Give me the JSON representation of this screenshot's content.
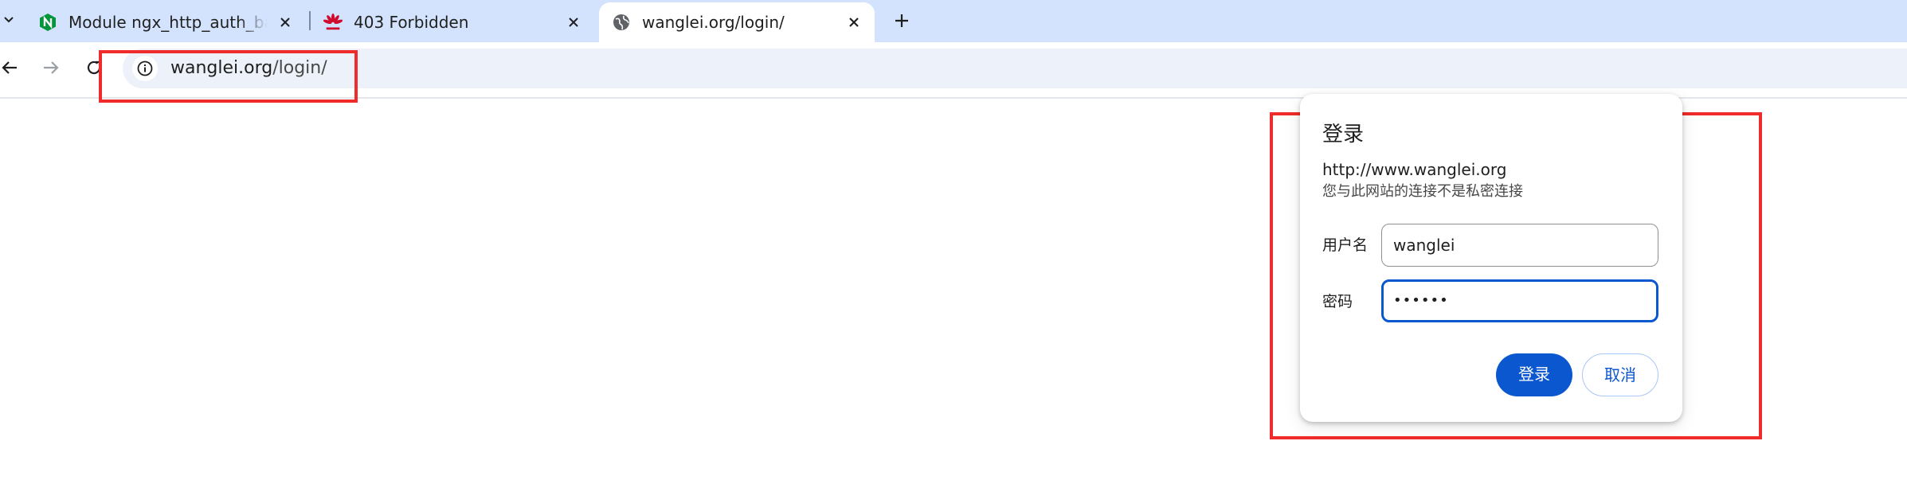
{
  "browser": {
    "tabs": [
      {
        "title": "Module ngx_http_auth_basic_module",
        "icon": "nginx-icon",
        "active": false
      },
      {
        "title": "403 Forbidden",
        "icon": "huawei-icon",
        "active": false
      },
      {
        "title": "wanglei.org/login/",
        "icon": "globe-icon",
        "active": true
      }
    ],
    "url_host": "wanglei.org",
    "url_path": "/login/"
  },
  "dialog": {
    "title": "登录",
    "origin": "http://www.wanglei.org",
    "warning": "您与此网站的连接不是私密连接",
    "username_label": "用户名",
    "username_value": "wanglei",
    "password_label": "密码",
    "password_value": "••••••",
    "ok_label": "登录",
    "cancel_label": "取消"
  },
  "colors": {
    "tabstrip": "#d3e3fd",
    "omnibox": "#edf2fa",
    "accent": "#0b57d0",
    "annotation": "#ef2b2b"
  }
}
